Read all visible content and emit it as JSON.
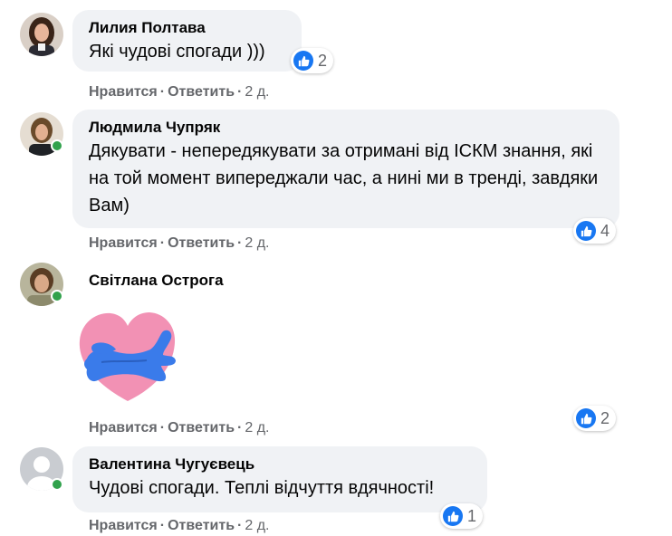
{
  "actions": {
    "like_label": "Нравится",
    "reply_label": "Ответить",
    "separator": "·"
  },
  "comments": [
    {
      "author": "Лилия Полтава",
      "text": "Які чудові спогади )))",
      "reactions": "2",
      "time": "2 д."
    },
    {
      "author": "Людмила Чупряк",
      "text": "Дякувати - непередякувати за отримані від ІСКМ знання, які на той момент випереджали час, а нині ми в тренді, завдяки Вам)",
      "reactions": "4",
      "time": "2 д."
    },
    {
      "author": "Світлана Острога",
      "sticker": "heart-hug-sticker",
      "reactions": "2",
      "time": "2 д."
    },
    {
      "author": "Валентина Чугуєвець",
      "text": "Чудові спогади. Теплі відчуття вдячності!",
      "reactions": "1",
      "time": "2 д."
    }
  ],
  "colors": {
    "like_blue": "#1877f2",
    "online_green": "#31a24c",
    "bubble_bg": "#f0f2f5",
    "meta_gray": "#65676b"
  }
}
